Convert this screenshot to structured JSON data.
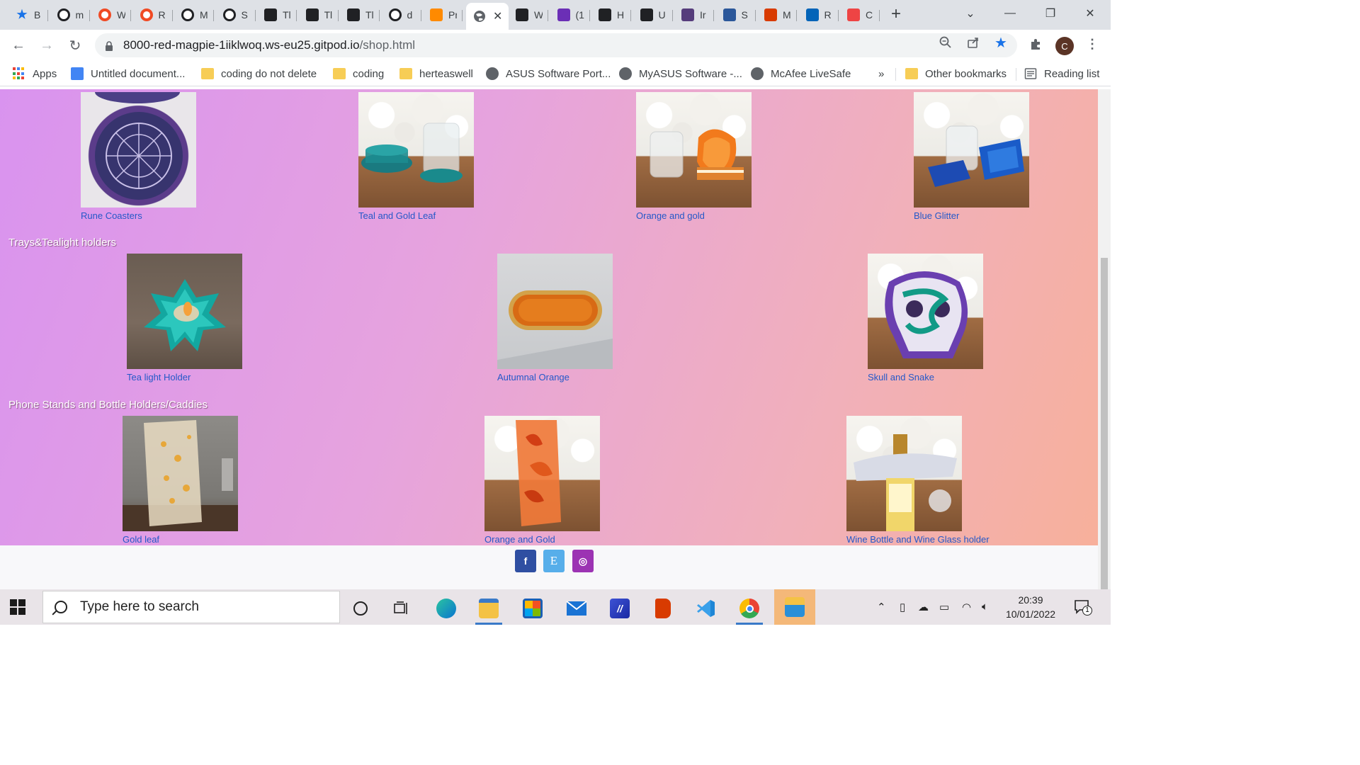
{
  "browser": {
    "tabs": [
      {
        "icon": "star-icon",
        "label": "B",
        "color": "#1a73e8"
      },
      {
        "icon": "github-icon",
        "label": "m",
        "color": "#202124"
      },
      {
        "icon": "opera-icon",
        "label": "W",
        "color": "#f04a24"
      },
      {
        "icon": "opera-icon",
        "label": "R",
        "color": "#f04a24"
      },
      {
        "icon": "github-icon",
        "label": "M",
        "color": "#202124"
      },
      {
        "icon": "github-icon",
        "label": "S",
        "color": "#202124"
      },
      {
        "icon": "codeinstitute-icon",
        "label": "Tl",
        "color": "#202124"
      },
      {
        "icon": "codeinstitute-icon",
        "label": "Tl",
        "color": "#202124"
      },
      {
        "icon": "codeinstitute-icon",
        "label": "Tl",
        "color": "#202124"
      },
      {
        "icon": "github-icon",
        "label": "d",
        "color": "#202124"
      },
      {
        "icon": "gitpod-icon",
        "label": "Pr",
        "color": "#ff8a00"
      }
    ],
    "active_tab_icon": "globe-icon",
    "tabs_right": [
      {
        "icon": "gitpod-icon",
        "label": "W",
        "color": "#202124"
      },
      {
        "icon": "mail-icon",
        "label": "(1",
        "color": "#6b2fb6"
      },
      {
        "icon": "hackerrank-icon",
        "label": "H",
        "color": "#202124"
      },
      {
        "icon": "udemy-icon",
        "label": "U",
        "color": "#202124"
      },
      {
        "icon": "bootstrap-icon",
        "label": "Ir",
        "color": "#563d7c"
      },
      {
        "icon": "word-icon",
        "label": "S",
        "color": "#2b579a"
      },
      {
        "icon": "office-icon",
        "label": "M",
        "color": "#d83b01"
      },
      {
        "icon": "onedrive-icon",
        "label": "R",
        "color": "#0364b8"
      },
      {
        "icon": "rainbow-icon",
        "label": "C",
        "color": "#e44"
      }
    ],
    "url_host": "8000-red-magpie-1iiklwoq.ws-eu25.gitpod.io",
    "url_path": "/shop.html",
    "bookmarks": [
      {
        "type": "apps",
        "label": "Apps"
      },
      {
        "type": "doc",
        "label": "Untitled document..."
      },
      {
        "type": "folder",
        "label": "coding do not delete"
      },
      {
        "type": "folder",
        "label": "coding"
      },
      {
        "type": "folder",
        "label": "herteaswell"
      },
      {
        "type": "globe",
        "label": "ASUS Software Port..."
      },
      {
        "type": "globe",
        "label": "MyASUS Software -..."
      },
      {
        "type": "globe",
        "label": "McAfee LiveSafe"
      }
    ],
    "bookmarks_more": "»",
    "other_bookmarks": "Other bookmarks",
    "reading_list": "Reading list",
    "avatar_letter": "C"
  },
  "shop": {
    "coasters": [
      {
        "caption": "Rune Coasters"
      },
      {
        "caption": "Teal and Gold Leaf"
      },
      {
        "caption": "Orange and gold"
      },
      {
        "caption": "Blue Glitter"
      }
    ],
    "trays_title": "Trays&Tealight holders",
    "trays": [
      {
        "caption": "Tea light Holder"
      },
      {
        "caption": "Autumnal Orange"
      },
      {
        "caption": "Skull and Snake"
      }
    ],
    "stands_title": "Phone Stands and Bottle Holders/Caddies",
    "stands": [
      {
        "caption": "Gold leaf"
      },
      {
        "caption": "Orange and Gold"
      },
      {
        "caption": "Wine Bottle and Wine Glass holder"
      }
    ],
    "social": [
      {
        "name": "facebook",
        "glyph": "f",
        "color": "#3b5998"
      },
      {
        "name": "etsy",
        "glyph": "E",
        "color": "#5aaee8"
      },
      {
        "name": "instagram",
        "glyph": "◎",
        "color": "#9b3bb5"
      }
    ]
  },
  "taskbar": {
    "search_placeholder": "Type here to search",
    "time": "20:39",
    "date": "10/01/2022",
    "notification_count": "1"
  }
}
